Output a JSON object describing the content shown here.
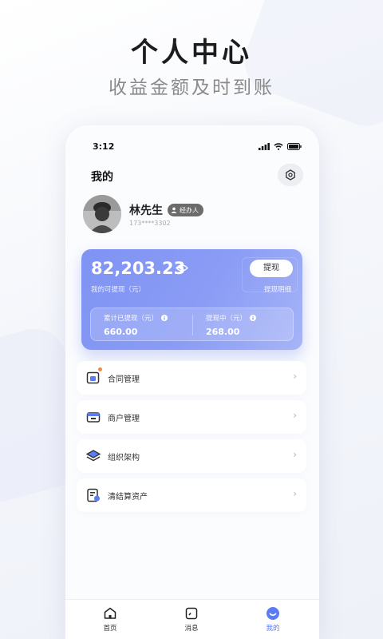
{
  "hero": {
    "title": "个人中心",
    "subtitle": "收益金额及时到账"
  },
  "status_bar": {
    "time": "3:12"
  },
  "header": {
    "title": "我的"
  },
  "profile": {
    "name": "林先生",
    "role_badge": "经办人",
    "phone": "173****3302"
  },
  "wallet": {
    "amount": "82,203.23",
    "amount_label": "我的可提现（元）",
    "withdraw_label": "提现",
    "detail_label": "提现明细",
    "stats": [
      {
        "label": "累计已提现（元）",
        "value": "660.00"
      },
      {
        "label": "提现中（元）",
        "value": "268.00"
      }
    ]
  },
  "menu": [
    {
      "label": "合同管理",
      "icon": "contract-icon",
      "has_dot": true
    },
    {
      "label": "商户管理",
      "icon": "store-icon",
      "has_dot": false
    },
    {
      "label": "组织架构",
      "icon": "layers-icon",
      "has_dot": false
    },
    {
      "label": "清结算资产",
      "icon": "settlement-icon",
      "has_dot": false
    }
  ],
  "tabbar": [
    {
      "label": "首页",
      "icon": "home-icon",
      "active": false
    },
    {
      "label": "消息",
      "icon": "message-icon",
      "active": false
    },
    {
      "label": "我的",
      "icon": "profile-icon",
      "active": true
    }
  ],
  "colors": {
    "accent": "#5b7cf4",
    "wallet_bg": "#8396f4",
    "notify_dot": "#f08a4b"
  }
}
